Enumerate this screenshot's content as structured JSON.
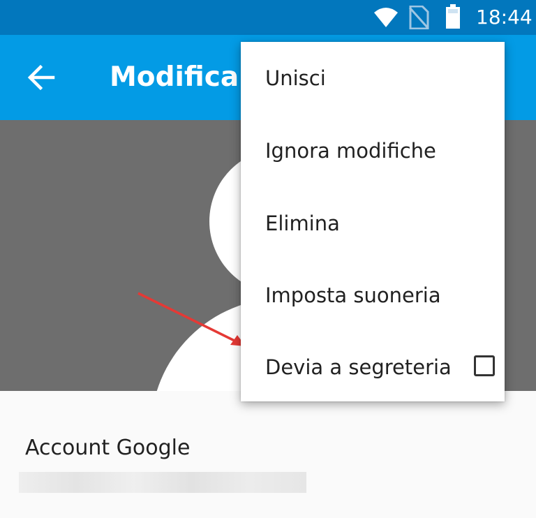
{
  "status_bar": {
    "time": "18:44",
    "icons": [
      "wifi-icon",
      "no-sim-icon",
      "battery-icon"
    ]
  },
  "app_bar": {
    "title": "Modifica contatto",
    "back_icon": "arrow-back-icon"
  },
  "colors": {
    "status_bar": "#0277bd",
    "app_bar": "#039be5",
    "photo_bg": "#6e6e6e",
    "annotation_arrow": "#e53935"
  },
  "menu": {
    "items": [
      {
        "label": "Unisci"
      },
      {
        "label": "Ignora modifiche"
      },
      {
        "label": "Elimina"
      },
      {
        "label": "Imposta suoneria"
      },
      {
        "label": "Devia a segreteria",
        "checkbox": false
      }
    ]
  },
  "account": {
    "label": "Account Google"
  }
}
